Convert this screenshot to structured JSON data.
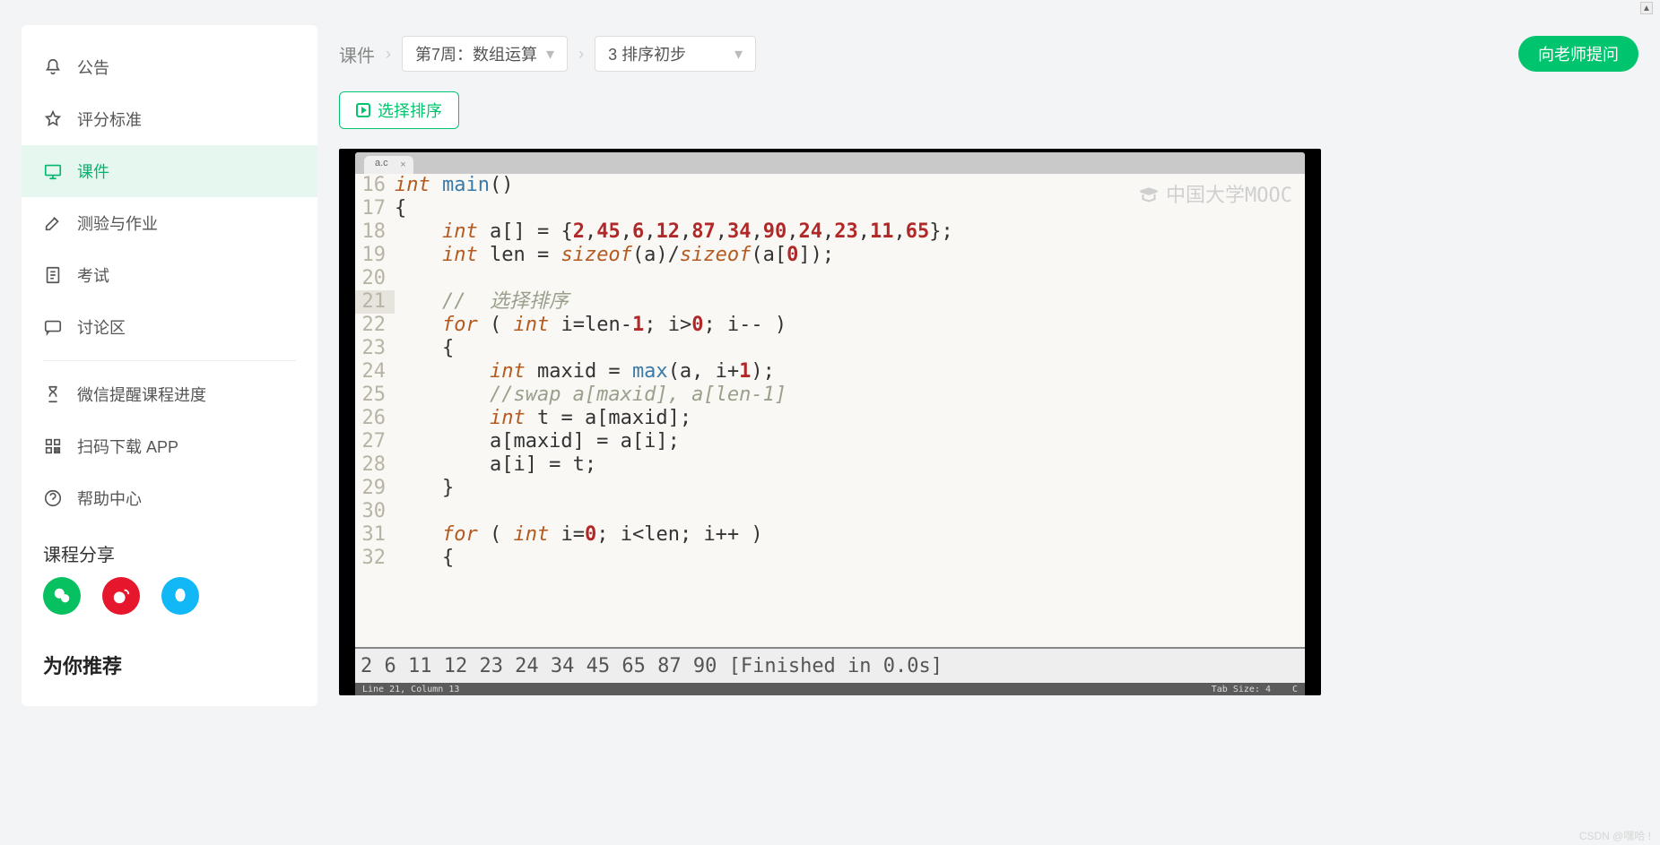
{
  "sidebar": {
    "items": [
      {
        "icon": "bell",
        "label": "公告"
      },
      {
        "icon": "star",
        "label": "评分标准"
      },
      {
        "icon": "lecture",
        "label": "课件",
        "active": true
      },
      {
        "icon": "edit",
        "label": "测验与作业"
      },
      {
        "icon": "doc",
        "label": "考试"
      },
      {
        "icon": "chat",
        "label": "讨论区"
      },
      {
        "icon": "hourglass",
        "label": "微信提醒课程进度"
      },
      {
        "icon": "qr",
        "label": "扫码下载 APP"
      },
      {
        "icon": "help",
        "label": "帮助中心"
      }
    ],
    "share_title": "课程分享",
    "share": [
      {
        "name": "wechat"
      },
      {
        "name": "weibo"
      },
      {
        "name": "qq"
      }
    ],
    "recommend_title": "为你推荐"
  },
  "breadcrumb": {
    "root": "课件",
    "week": "第7周：数组运算",
    "section": "3 排序初步",
    "ask": "向老师提问"
  },
  "chip": "选择排序",
  "editor": {
    "tab": "a.c",
    "watermark": "中国大学MOOC",
    "lines": [
      {
        "n": 16,
        "html": "<span class='kw'>int</span> <span class='fn'>main</span>()"
      },
      {
        "n": 17,
        "html": "{"
      },
      {
        "n": 18,
        "html": "    <span class='kw'>int</span> a[] = {<span class='num'>2</span>,<span class='num'>45</span>,<span class='num'>6</span>,<span class='num'>12</span>,<span class='num'>87</span>,<span class='num'>34</span>,<span class='num'>90</span>,<span class='num'>24</span>,<span class='num'>23</span>,<span class='num'>11</span>,<span class='num'>65</span>};"
      },
      {
        "n": 19,
        "html": "    <span class='kw'>int</span> len = <span class='kw'>sizeof</span>(a)/<span class='kw'>sizeof</span>(a[<span class='num'>0</span>]);"
      },
      {
        "n": 20,
        "html": ""
      },
      {
        "n": 21,
        "html": "    <span class='cm'>//  选择排序</span>",
        "hl": true
      },
      {
        "n": 22,
        "html": "    <span class='kw'>for</span> ( <span class='kw'>int</span> i=len-<span class='num'>1</span>; i&gt;<span class='num'>0</span>; i-- )"
      },
      {
        "n": 23,
        "html": "    {"
      },
      {
        "n": 24,
        "html": "        <span class='kw'>int</span> maxid = <span class='fn'>max</span>(a, i+<span class='num'>1</span>);"
      },
      {
        "n": 25,
        "html": "        <span class='cm'>//swap a[maxid], a[len-1]</span>"
      },
      {
        "n": 26,
        "html": "        <span class='kw'>int</span> t = a[maxid];"
      },
      {
        "n": 27,
        "html": "        a[maxid] = a[i];"
      },
      {
        "n": 28,
        "html": "        a[i] = t;"
      },
      {
        "n": 29,
        "html": "    }"
      },
      {
        "n": 30,
        "html": ""
      },
      {
        "n": 31,
        "html": "    <span class='kw'>for</span> ( <span class='kw'>int</span> i=<span class='num'>0</span>; i&lt;len; i++ )"
      },
      {
        "n": 32,
        "html": "    {"
      }
    ],
    "output": "2 6 11 12 23 24 34 45 65 87 90  [Finished in 0.0s]",
    "status_left": "Line 21, Column 13",
    "status_tab": "Tab Size: 4",
    "status_lang": "C"
  },
  "csdn": "CSDN @嘿哈 !"
}
